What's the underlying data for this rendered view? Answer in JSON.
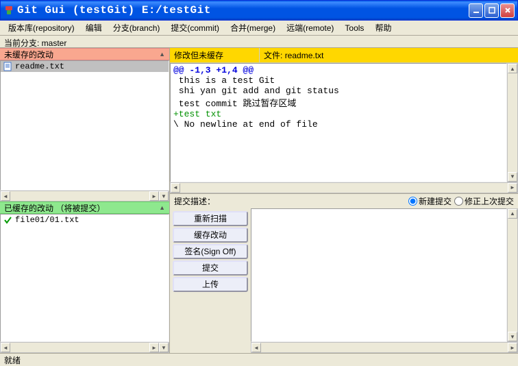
{
  "window": {
    "title": "Git Gui (testGit) E:/testGit"
  },
  "menu": {
    "repository": "版本库(repository)",
    "edit": "编辑",
    "branch": "分支(branch)",
    "commit": "提交(commit)",
    "merge": "合并(merge)",
    "remote": "远端(remote)",
    "tools": "Tools",
    "help": "帮助"
  },
  "branch_line": "当前分支: master",
  "panels": {
    "unstaged_header": "未缓存的改动",
    "staged_header": "已缓存的改动 （将被提交）",
    "diff_header_left": "修改但未缓存",
    "diff_file_prefix": "文件:",
    "diff_file_name": "readme.txt"
  },
  "unstaged_files": [
    {
      "name": "readme.txt",
      "selected": true
    }
  ],
  "staged_files": [
    {
      "name": "file01/01.txt"
    }
  ],
  "diff": {
    "hunk": "@@ -1,3 +1,4 @@",
    "lines": [
      " this is a test Git",
      " shi yan git add and git status",
      " test commit 跳过暂存区域"
    ],
    "added": "+test txt",
    "footer": "\\ No newline at end of file"
  },
  "commit": {
    "desc_label": "提交描述：",
    "radio_new": "新建提交",
    "radio_amend": "修正上次提交"
  },
  "buttons": {
    "rescan": "重新扫描",
    "stage": "缓存改动",
    "signoff": "签名(Sign Off)",
    "commit": "提交",
    "push": "上传"
  },
  "status": "就绪"
}
